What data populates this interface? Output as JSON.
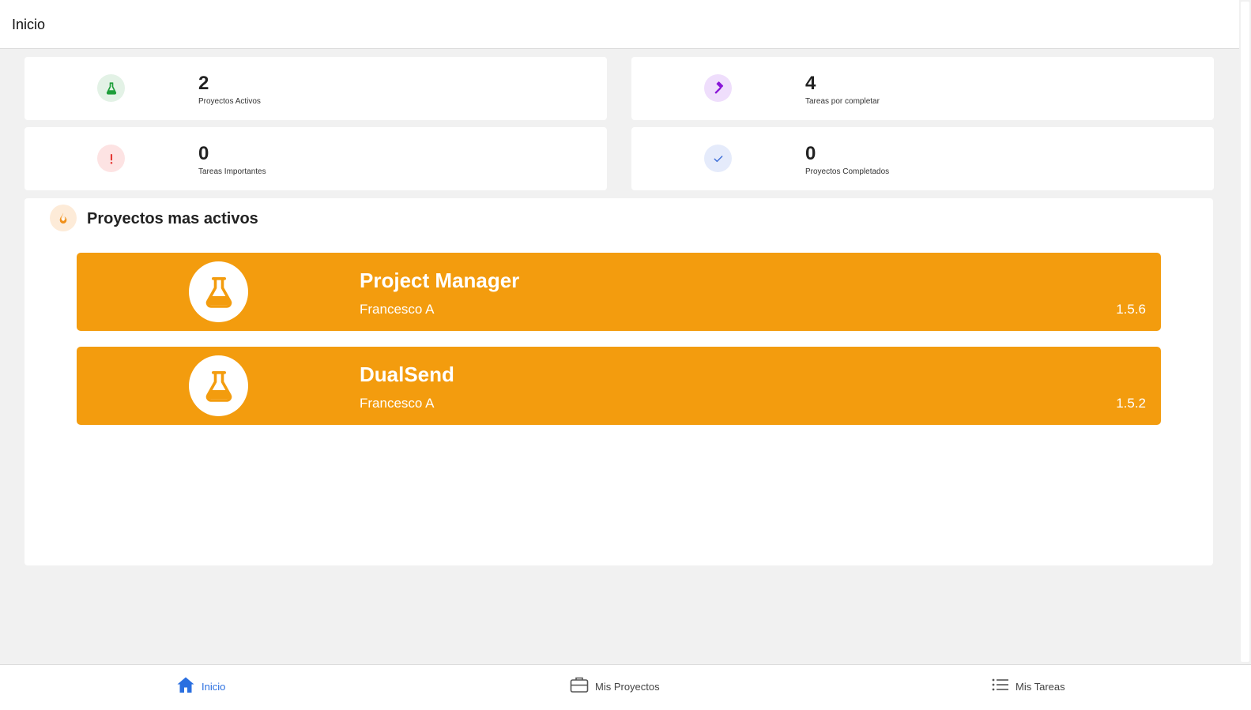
{
  "header": {
    "title": "Inicio"
  },
  "stats": [
    {
      "value": "2",
      "label": "Proyectos Activos",
      "icon": "flask-icon",
      "color": "#1e9e3a",
      "bg": "#e3f2e6"
    },
    {
      "value": "4",
      "label": "Tareas por completar",
      "icon": "hammer-icon",
      "color": "#8a17d8",
      "bg": "#efdefc"
    },
    {
      "value": "0",
      "label": "Tareas Importantes",
      "icon": "exclamation-icon",
      "color": "#e53935",
      "bg": "#fde3e3"
    },
    {
      "value": "0",
      "label": "Proyectos Completados",
      "icon": "check-icon",
      "color": "#3f6fd8",
      "bg": "#e5ebfb"
    }
  ],
  "section": {
    "title": "Proyectos mas activos",
    "icon": "fire-icon",
    "icon_color": "#f0901a"
  },
  "projects": [
    {
      "name": "Project Manager",
      "owner": "Francesco A",
      "version": "1.5.6",
      "icon": "flask-icon",
      "color": "#f39c0e"
    },
    {
      "name": "DualSend",
      "owner": "Francesco A",
      "version": "1.5.2",
      "icon": "flask-icon",
      "color": "#f39c0e"
    }
  ],
  "nav": [
    {
      "label": "Inicio",
      "icon": "home-icon",
      "active": true
    },
    {
      "label": "Mis Proyectos",
      "icon": "briefcase-icon",
      "active": false
    },
    {
      "label": "Mis Tareas",
      "icon": "list-icon",
      "active": false
    }
  ],
  "colors": {
    "accent": "#2a6fe0",
    "project_card": "#f39c0e",
    "background": "#f1f1f1"
  }
}
